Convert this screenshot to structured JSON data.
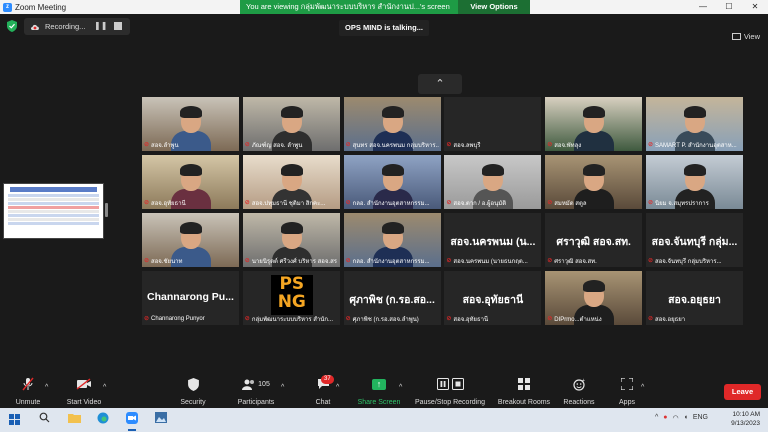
{
  "window": {
    "title": "Zoom Meeting",
    "controls": [
      "—",
      "☐",
      "✕"
    ]
  },
  "topbar": {
    "recording_label": "Recording...",
    "banner_text": "You are viewing กลุ่มพัฒนาระบบบริหาร สำนักงานป...'s screen",
    "view_options": "View Options",
    "talking": "OPS MIND is talking...",
    "view_label": "View"
  },
  "tiles": [
    {
      "row": 0,
      "col": 0,
      "type": "video",
      "name": "สอจ.ลำพูน"
    },
    {
      "row": 0,
      "col": 1,
      "type": "video",
      "name": "ภัณฑ์ญ สอจ. ลำพูน"
    },
    {
      "row": 0,
      "col": 2,
      "type": "video",
      "name": "สุนทร สอจ.นครพนม กลุ่มบริหาร..."
    },
    {
      "row": 0,
      "col": 3,
      "type": "empty",
      "name": "สอจ.ลพบุรี"
    },
    {
      "row": 0,
      "col": 4,
      "type": "video",
      "name": "สอจ.พัทลุง"
    },
    {
      "row": 0,
      "col": 5,
      "type": "video",
      "name": "SAMART P. สำนักงานอุตสาห..."
    },
    {
      "row": 1,
      "col": 0,
      "type": "video",
      "name": "สอจ.อุทัยธานี"
    },
    {
      "row": 1,
      "col": 1,
      "type": "video",
      "name": "สอจ.ปทุมธานี ชุติมา สิกคะ..."
    },
    {
      "row": 1,
      "col": 2,
      "type": "video",
      "name": "กลอ. สำนักงานอุตสาหกรรม..."
    },
    {
      "row": 1,
      "col": 3,
      "type": "video",
      "name": "สอจ.ตาก / อ.ผู้อนุมัติ"
    },
    {
      "row": 1,
      "col": 4,
      "type": "video",
      "name": "สมหมัด สตูล"
    },
    {
      "row": 1,
      "col": 5,
      "type": "video",
      "name": "นิยม จ.สมุทรปราการ"
    },
    {
      "row": 2,
      "col": 0,
      "type": "video",
      "name": "สอจ.ชัยนาท"
    },
    {
      "row": 2,
      "col": 1,
      "type": "video",
      "name": "นายนิรุตต์ ศรีวงศ์ บริหาร สอจ.สร"
    },
    {
      "row": 2,
      "col": 2,
      "type": "video",
      "name": "กลอ. สำนักงานอุตสาหกรรม..."
    },
    {
      "row": 2,
      "col": 3,
      "type": "text",
      "big": "สอจ.นครพนม (น...",
      "name": "สอจ.นครพนม (นายธนกฤต..."
    },
    {
      "row": 2,
      "col": 4,
      "type": "text",
      "big": "ศราวุฒิ สอจ.สท.",
      "name": "ศราวุฒิ สอจ.สท."
    },
    {
      "row": 2,
      "col": 5,
      "type": "text",
      "big": "สอจ.จันทบุรี กลุ่ม...",
      "name": "สอจ.จันทบุรี กลุ่มบริหาร..."
    },
    {
      "row": 3,
      "col": 0,
      "type": "text",
      "big": "Channarong Pu...",
      "name": "Channarong Punyor"
    },
    {
      "row": 3,
      "col": 1,
      "type": "logo",
      "name": "กลุ่มพัฒนาระบบบริหาร สำนัก...",
      "logo_text": "PSNG"
    },
    {
      "row": 3,
      "col": 2,
      "type": "text",
      "big": "ศุภาพิช (ก.รอ.สอ...",
      "name": "ศุภาพิช (ก.รอ.สอจ.ลำพูน)"
    },
    {
      "row": 3,
      "col": 3,
      "type": "text",
      "big": "สอจ.อุทัยธานี",
      "name": "สอจ.อุทัยธานี"
    },
    {
      "row": 3,
      "col": 4,
      "type": "video",
      "name": "DIPrmo...ตำแหน่ง"
    },
    {
      "row": 3,
      "col": 5,
      "type": "text",
      "big": "สอจ.อยุธยา",
      "name": "สอจ.อยุธยา"
    }
  ],
  "toolbar": {
    "unmute": "Unmute",
    "start_video": "Start Video",
    "security": "Security",
    "participants": "Participants",
    "participants_count": "105",
    "chat": "Chat",
    "chat_badge": "37",
    "share_screen": "Share Screen",
    "pause_stop": "Pause/Stop Recording",
    "breakout": "Breakout Rooms",
    "reactions": "Reactions",
    "apps": "Apps",
    "leave": "Leave"
  },
  "taskbar": {
    "time": "10:10 AM",
    "date": "9/13/2023",
    "lang": "ENG"
  },
  "colors": {
    "accent_green": "#1e9b45",
    "leave_red": "#e02828",
    "share_green": "#22b35e"
  }
}
